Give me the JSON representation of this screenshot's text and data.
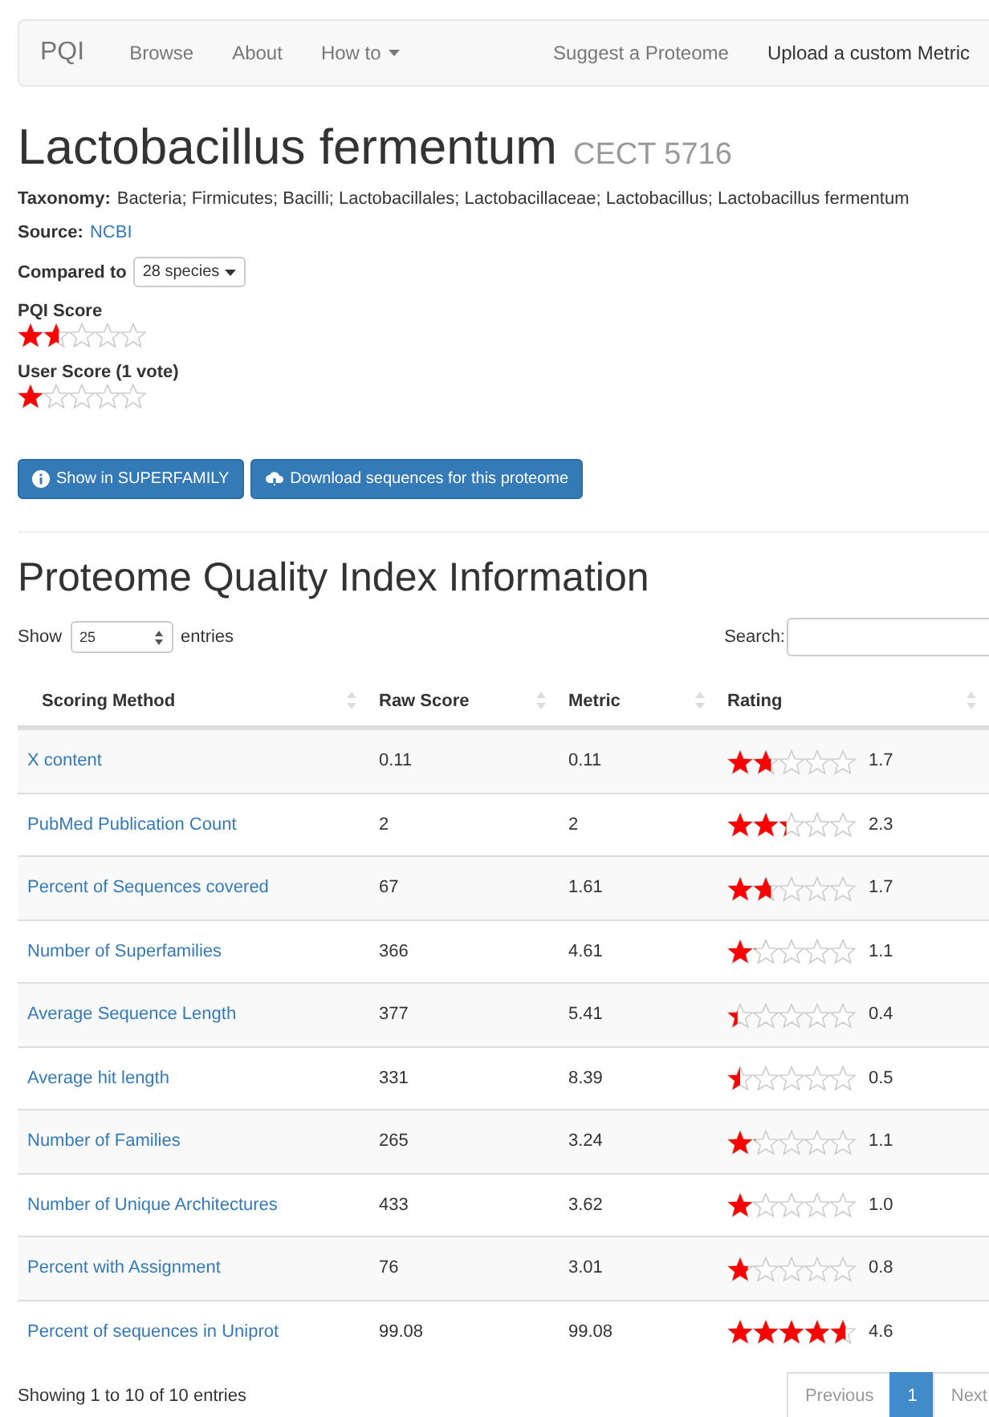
{
  "navbar": {
    "brand": "PQI",
    "left_items": [
      {
        "label": "Browse",
        "dropdown": false
      },
      {
        "label": "About",
        "dropdown": false
      },
      {
        "label": "How to",
        "dropdown": true
      }
    ],
    "right_items": [
      {
        "label": "Suggest a Proteome",
        "selected": false
      },
      {
        "label": "Upload a custom Metric",
        "selected": true
      }
    ]
  },
  "title": "Lactobacillus fermentum",
  "strain": "CECT 5716",
  "taxonomy": {
    "label": "Taxonomy:",
    "value": "Bacteria; Firmicutes; Bacilli; Lactobacillales; Lactobacillaceae; Lactobacillus; Lactobacillus fermentum"
  },
  "source": {
    "label": "Source:",
    "link": "NCBI"
  },
  "compared_to": {
    "label": "Compared to",
    "value": "28 species"
  },
  "scores": [
    {
      "label": "PQI Score",
      "stars": 1.6
    },
    {
      "label": "User Score (1 vote)",
      "stars": 1
    }
  ],
  "buttons": [
    {
      "label": "Show in SUPERFAMILY",
      "kind": "info"
    },
    {
      "label": "Download sequences for this proteome",
      "kind": "download"
    }
  ],
  "section_title": "Proteome Quality Index Information",
  "length_control": {
    "before": "Show",
    "value": "25",
    "after": "entries"
  },
  "search": {
    "label": "Search:"
  },
  "table": {
    "columns": [
      "Scoring Method",
      "Raw Score",
      "Metric",
      "Rating"
    ],
    "rows": [
      {
        "method": "X content",
        "raw": "0.11",
        "metric": "0.11",
        "stars": 1.7,
        "rating": "1.7"
      },
      {
        "method": "PubMed Publication Count",
        "raw": "2",
        "metric": "2",
        "stars": 2.3,
        "rating": "2.3"
      },
      {
        "method": "Percent of Sequences covered",
        "raw": "67",
        "metric": "1.61",
        "stars": 1.7,
        "rating": "1.7"
      },
      {
        "method": "Number of Superfamilies",
        "raw": "366",
        "metric": "4.61",
        "stars": 1.1,
        "rating": "1.1"
      },
      {
        "method": "Average Sequence Length",
        "raw": "377",
        "metric": "5.41",
        "stars": 0.4,
        "rating": "0.4"
      },
      {
        "method": "Average hit length",
        "raw": "331",
        "metric": "8.39",
        "stars": 0.5,
        "rating": "0.5"
      },
      {
        "method": "Number of Families",
        "raw": "265",
        "metric": "3.24",
        "stars": 1.1,
        "rating": "1.1"
      },
      {
        "method": "Number of Unique Architectures",
        "raw": "433",
        "metric": "3.62",
        "stars": 1.0,
        "rating": "1.0"
      },
      {
        "method": "Percent with Assignment",
        "raw": "76",
        "metric": "3.01",
        "stars": 0.8,
        "rating": "0.8"
      },
      {
        "method": "Percent of sequences in Uniprot",
        "raw": "99.08",
        "metric": "99.08",
        "stars": 4.6,
        "rating": "4.6"
      }
    ]
  },
  "info": "Showing 1 to 10 of 10 entries",
  "pagination": [
    {
      "label": "Previous",
      "selected": false
    },
    {
      "label": "1",
      "selected": true
    },
    {
      "label": "Next",
      "selected": false
    }
  ]
}
